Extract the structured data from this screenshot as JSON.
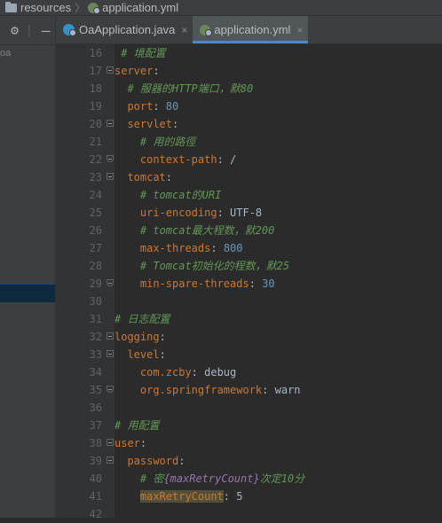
{
  "breadcrumb": {
    "folder": "resources",
    "file": "application.yml"
  },
  "sidebar": {
    "partial_label": "oa"
  },
  "tabs": [
    {
      "label": "OaApplication.java",
      "icon": "java-class-icon",
      "active": false
    },
    {
      "label": "application.yml",
      "icon": "yaml-file-icon",
      "active": true
    }
  ],
  "close_glyph": "×",
  "lines": [
    {
      "n": "16",
      "tokens": [
        [
          "c",
          "# 境配置"
        ]
      ],
      "indent": 1
    },
    {
      "n": "17",
      "tokens": [
        [
          "k",
          "server"
        ],
        [
          "s",
          ":"
        ]
      ],
      "indent": 0,
      "fold": "start"
    },
    {
      "n": "18",
      "tokens": [
        [
          "c",
          "# 服器的HTTP端口，默80"
        ]
      ],
      "indent": 2
    },
    {
      "n": "19",
      "tokens": [
        [
          "k",
          "port"
        ],
        [
          "s",
          ": "
        ],
        [
          "v",
          "80"
        ]
      ],
      "indent": 2
    },
    {
      "n": "20",
      "tokens": [
        [
          "k",
          "servlet"
        ],
        [
          "s",
          ":"
        ]
      ],
      "indent": 2,
      "fold": "start"
    },
    {
      "n": "21",
      "tokens": [
        [
          "c",
          "# 用的路徑"
        ]
      ],
      "indent": 4
    },
    {
      "n": "22",
      "tokens": [
        [
          "k",
          "context-path"
        ],
        [
          "s",
          ": /"
        ]
      ],
      "indent": 4,
      "fold": "end"
    },
    {
      "n": "23",
      "tokens": [
        [
          "k",
          "tomcat"
        ],
        [
          "s",
          ":"
        ]
      ],
      "indent": 2,
      "fold": "start"
    },
    {
      "n": "24",
      "tokens": [
        [
          "c",
          "# tomcat的URI"
        ]
      ],
      "indent": 4
    },
    {
      "n": "25",
      "tokens": [
        [
          "k",
          "uri-encoding"
        ],
        [
          "s",
          ": UTF-8"
        ]
      ],
      "indent": 4
    },
    {
      "n": "26",
      "tokens": [
        [
          "c",
          "# tomcat最大程数，默200"
        ]
      ],
      "indent": 4
    },
    {
      "n": "27",
      "tokens": [
        [
          "k",
          "max-threads"
        ],
        [
          "s",
          ": "
        ],
        [
          "v",
          "800"
        ]
      ],
      "indent": 4
    },
    {
      "n": "28",
      "tokens": [
        [
          "c",
          "# Tomcat初始化的程数，默25"
        ]
      ],
      "indent": 4
    },
    {
      "n": "29",
      "tokens": [
        [
          "k",
          "min-spare-threads"
        ],
        [
          "s",
          ": "
        ],
        [
          "v",
          "30"
        ]
      ],
      "indent": 4,
      "fold": "end"
    },
    {
      "n": "30",
      "tokens": [],
      "indent": 0
    },
    {
      "n": "31",
      "tokens": [
        [
          "c",
          "# 日志配置"
        ]
      ],
      "indent": 0
    },
    {
      "n": "32",
      "tokens": [
        [
          "k",
          "logging"
        ],
        [
          "s",
          ":"
        ]
      ],
      "indent": 0,
      "fold": "start"
    },
    {
      "n": "33",
      "tokens": [
        [
          "k",
          "level"
        ],
        [
          "s",
          ":"
        ]
      ],
      "indent": 2,
      "fold": "start"
    },
    {
      "n": "34",
      "tokens": [
        [
          "k",
          "com.zcby"
        ],
        [
          "s",
          ": debug"
        ]
      ],
      "indent": 4
    },
    {
      "n": "35",
      "tokens": [
        [
          "k",
          "org.springframework"
        ],
        [
          "s",
          ": warn"
        ]
      ],
      "indent": 4,
      "fold": "end"
    },
    {
      "n": "36",
      "tokens": [],
      "indent": 0
    },
    {
      "n": "37",
      "tokens": [
        [
          "c",
          "# 用配置"
        ]
      ],
      "indent": 0
    },
    {
      "n": "38",
      "tokens": [
        [
          "k",
          "user"
        ],
        [
          "s",
          ":"
        ]
      ],
      "indent": 0,
      "fold": "start"
    },
    {
      "n": "39",
      "tokens": [
        [
          "k",
          "password"
        ],
        [
          "s",
          ":"
        ]
      ],
      "indent": 2,
      "fold": "start"
    },
    {
      "n": "40",
      "tokens": [
        [
          "c",
          "# 密"
        ],
        [
          "tp",
          "{maxRetryCount}"
        ],
        [
          "c",
          "次定10分"
        ]
      ],
      "indent": 4
    },
    {
      "n": "41",
      "tokens": [
        [
          "khl",
          "maxRetryCount"
        ],
        [
          "s",
          ": 5"
        ]
      ],
      "indent": 4
    },
    {
      "n": "42",
      "tokens": [],
      "indent": 0
    }
  ]
}
